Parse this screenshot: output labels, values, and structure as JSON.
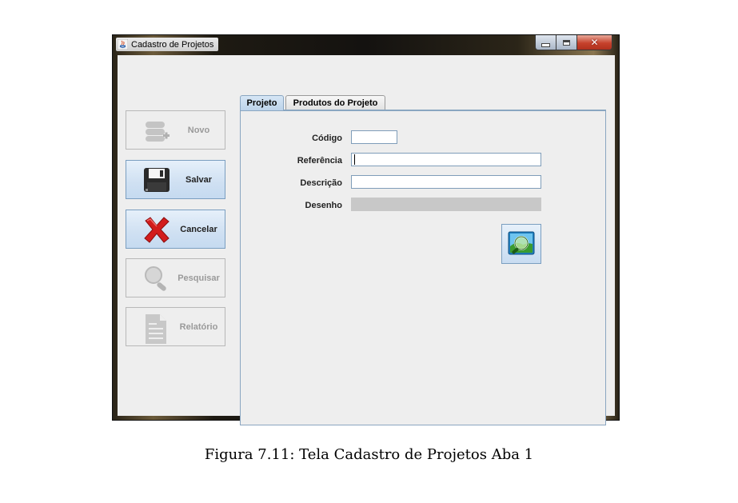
{
  "window": {
    "title": "Cadastro de Projetos",
    "controls": {
      "minimize": "minimize-icon",
      "maximize": "maximize-icon",
      "close": "close-icon"
    }
  },
  "sidebar": {
    "buttons": [
      {
        "label": "Novo",
        "icon": "new-record-icon",
        "enabled": false
      },
      {
        "label": "Salvar",
        "icon": "floppy-disk-icon",
        "enabled": true
      },
      {
        "label": "Cancelar",
        "icon": "red-x-icon",
        "enabled": true
      },
      {
        "label": "Pesquisar",
        "icon": "magnifier-icon",
        "enabled": false
      },
      {
        "label": "Relatório",
        "icon": "document-icon",
        "enabled": false
      }
    ]
  },
  "tabs": [
    {
      "label": "Projeto",
      "active": true
    },
    {
      "label": "Produtos do Projeto",
      "active": false
    }
  ],
  "form": {
    "codigo_label": "Código",
    "codigo_value": "",
    "referencia_label": "Referência",
    "referencia_value": "",
    "descricao_label": "Descrição",
    "descricao_value": "",
    "desenho_label": "Desenho",
    "desenho_value": "",
    "image_search_icon": "image-search-icon"
  },
  "colors": {
    "accent_border": "#7a9ec0",
    "button_gradient_top": "#e6f0fa",
    "disabled_field": "#c8c8c8"
  },
  "caption": "Figura 7.11: Tela Cadastro de Projetos Aba 1"
}
